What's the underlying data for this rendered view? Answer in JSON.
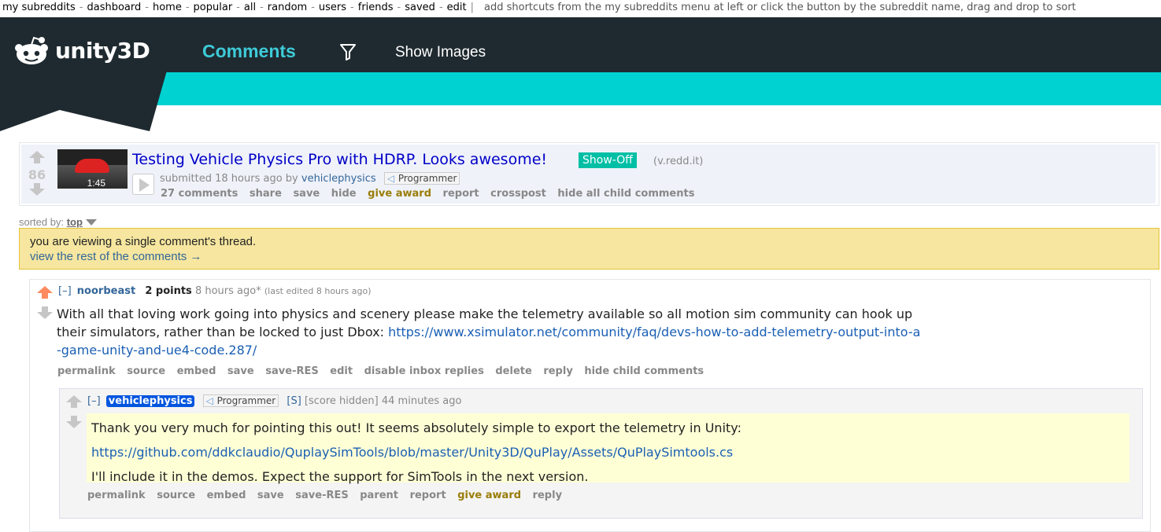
{
  "srbar": {
    "items": [
      "my subreddits",
      "dashboard",
      "home",
      "popular",
      "all",
      "random",
      "users",
      "friends",
      "saved",
      "edit"
    ],
    "hint": "add shortcuts from the my subreddits menu at left or click the button by the subreddit name, drag and drop to sort"
  },
  "header": {
    "logo_text": "unity3D",
    "tab_comments": "Comments",
    "show_images": "Show Images"
  },
  "post": {
    "score": "86",
    "thumb_duration": "1:45",
    "title": "Testing Vehicle Physics Pro with HDRP. Looks awesome!",
    "flair": "Show-Off",
    "domain": "(v.redd.it)",
    "submitted": "submitted 18 hours ago by",
    "author": "vehiclephysics",
    "author_flair": "Programmer",
    "buttons": [
      "27 comments",
      "share",
      "save",
      "hide",
      "give award",
      "report",
      "crosspost",
      "hide all child comments"
    ]
  },
  "sort": {
    "label": "sorted by:",
    "value": "top"
  },
  "info": {
    "line1": "you are viewing a single comment's thread.",
    "line2": "view the rest of the comments →"
  },
  "comment1": {
    "expand": "[–]",
    "author": "noorbeast",
    "score": "2 points",
    "time": "8 hours ago*",
    "edited": "(last edited 8 hours ago)",
    "text": "With all that loving work going into physics and scenery please make the telemetry available so all motion sim community can hook up their simulators, rather than be locked to just Dbox: ",
    "link": "https://www.xsimulator.net/community/faq/devs-how-to-add-telemetry-output-into-a-game-unity-and-ue4-code.287/",
    "buttons": [
      "permalink",
      "source",
      "embed",
      "save",
      "save-RES",
      "edit",
      "disable inbox replies",
      "delete",
      "reply",
      "hide child comments"
    ]
  },
  "comment2": {
    "expand": "[–]",
    "author": "vehiclephysics",
    "author_flair": "Programmer",
    "submitter_tag": "[S]",
    "score": "[score hidden]",
    "time": "44 minutes ago",
    "line1": "Thank you very much for pointing this out! It seems absolutely simple to export the telemetry in Unity:",
    "link": "https://github.com/ddkclaudio/QuplaySimTools/blob/master/Unity3D/QuPlay/Assets/QuPlaySimtools.cs",
    "line3": "I'll include it in the demos. Expect the support for SimTools in the next version.",
    "buttons": [
      "permalink",
      "source",
      "embed",
      "save",
      "save-RES",
      "parent",
      "report",
      "give award",
      "reply"
    ]
  }
}
